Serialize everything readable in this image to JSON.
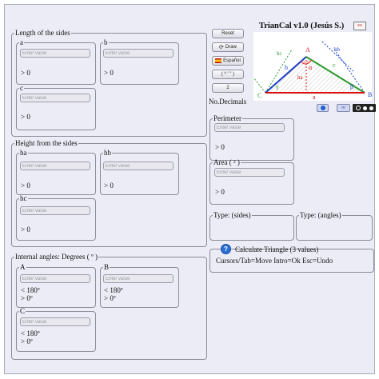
{
  "app": {
    "title": "TrianCal v1.0 (Jesús S.)",
    "decimals_label": "No.Decimals",
    "decimals_value": "2"
  },
  "buttons": {
    "reset": "Reset",
    "draw": "Draw",
    "language": "Español",
    "angle_units": "( º ' \" )",
    "decimals": "2"
  },
  "sides": {
    "legend": "Length of the sides",
    "a": {
      "label": "a",
      "placeholder": "Enter value",
      "note": "> 0"
    },
    "b": {
      "label": "b",
      "placeholder": "Enter value",
      "note": "> 0"
    },
    "c": {
      "label": "c",
      "placeholder": "Enter value",
      "note": "> 0"
    }
  },
  "heights": {
    "legend": "Height from the sides",
    "ha": {
      "label": "ha",
      "placeholder": "Enter value",
      "note": "> 0"
    },
    "hb": {
      "label": "hb",
      "placeholder": "Enter value",
      "note": "> 0"
    },
    "hc": {
      "label": "hc",
      "placeholder": "Enter value",
      "note": "> 0"
    }
  },
  "angles": {
    "legend": "Internal angles: Degrees ( º )",
    "A": {
      "label": "A",
      "placeholder": "Enter value",
      "note1": "< 180º",
      "note2": "> 0º"
    },
    "B": {
      "label": "B",
      "placeholder": "Enter value",
      "note1": "< 180º",
      "note2": "> 0º"
    },
    "C": {
      "label": "C",
      "placeholder": "Enter value",
      "note1": "< 180º",
      "note2": "> 0º"
    }
  },
  "perimeter": {
    "legend": "Perimeter",
    "placeholder": "Enter value",
    "note": "> 0"
  },
  "area": {
    "legend": "Area ( ² )",
    "placeholder": "Enter value",
    "note": "> 0"
  },
  "type_sides": {
    "legend": "Type: (sides)"
  },
  "type_angles": {
    "legend": "Type: (angles)"
  },
  "calculate": {
    "title": "Calculate Triangle (3 values)",
    "help": "Cursors/Tab=Move Intro=Ok Esc=Undo"
  },
  "diagram": {
    "A": "A",
    "B": "B",
    "C": "C",
    "a": "a",
    "b": "b",
    "c": "c",
    "ha": "ha",
    "hb": "hb",
    "hc": "hc",
    "alpha": "α",
    "beta": "β",
    "gamma": "γ"
  },
  "colors": {
    "accent_blue": "#2060d0",
    "side_red": "#d11",
    "side_blue": "#1a3fbf",
    "side_green": "#2c9a2c"
  }
}
